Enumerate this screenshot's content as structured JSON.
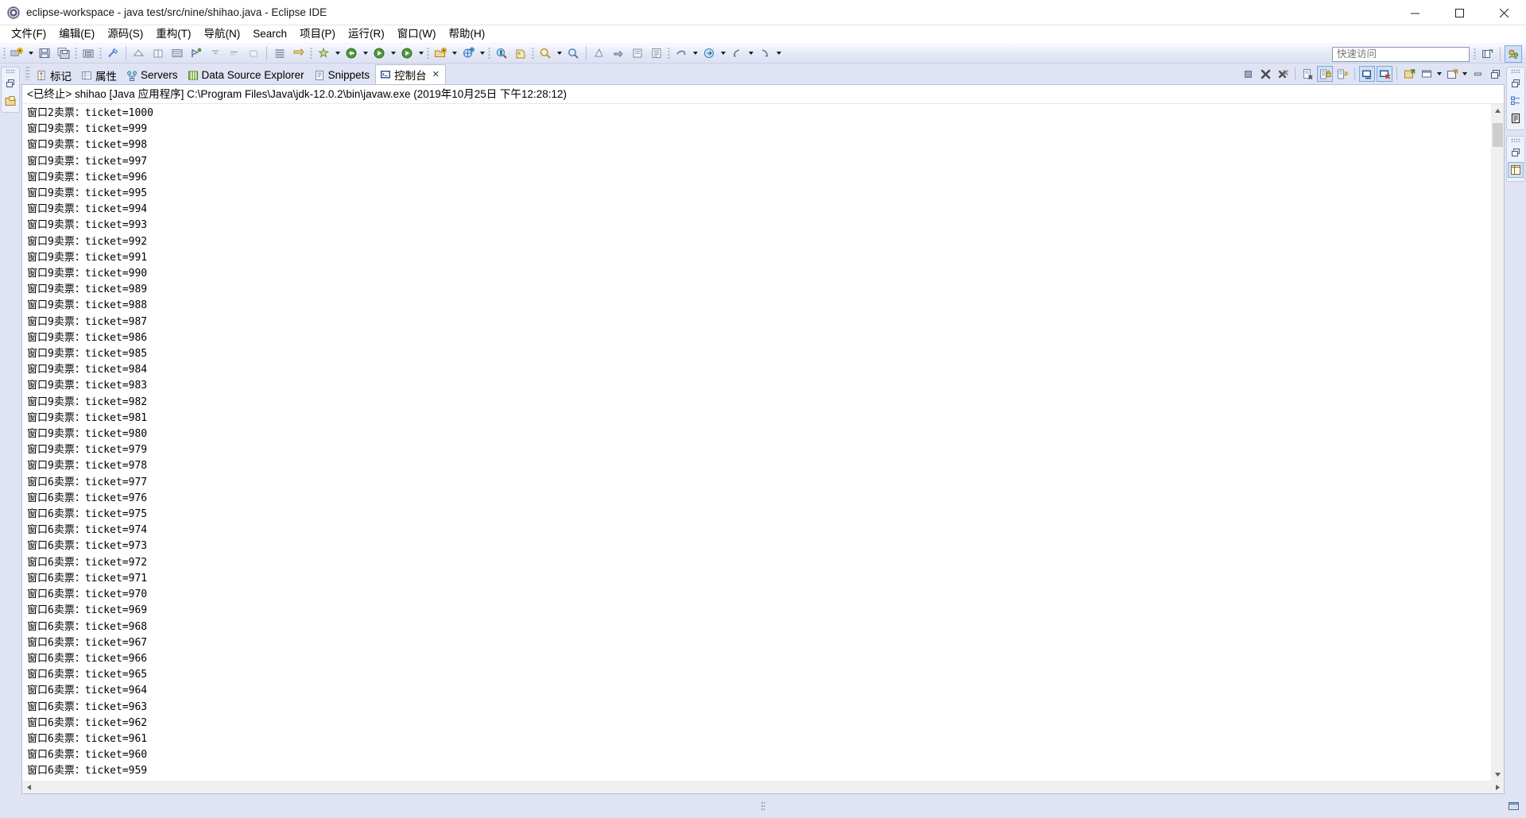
{
  "window": {
    "title": "eclipse-workspace - java test/src/nine/shihao.java - Eclipse IDE",
    "app_icon": "eclipse-icon",
    "minimize_label": "Minimize",
    "maximize_label": "Maximize",
    "close_label": "Close"
  },
  "menubar": {
    "items": [
      {
        "label": "文件(F)",
        "name": "menu-file"
      },
      {
        "label": "编辑(E)",
        "name": "menu-edit"
      },
      {
        "label": "源码(S)",
        "name": "menu-source"
      },
      {
        "label": "重构(T)",
        "name": "menu-refactor"
      },
      {
        "label": "导航(N)",
        "name": "menu-navigate"
      },
      {
        "label": "Search",
        "name": "menu-search"
      },
      {
        "label": "项目(P)",
        "name": "menu-project"
      },
      {
        "label": "运行(R)",
        "name": "menu-run"
      },
      {
        "label": "窗口(W)",
        "name": "menu-window"
      },
      {
        "label": "帮助(H)",
        "name": "menu-help"
      }
    ]
  },
  "toolbar": {
    "quick_access_placeholder": "快速访问",
    "icons": [
      "new-wizard-icon",
      "save-icon",
      "save-all-icon",
      "print-icon",
      "new-java-class-icon",
      "link-editor-icon",
      "open-type-icon",
      "build-all-icon",
      "toggle-breakpoint-icon",
      "debug-icon",
      "run-icon",
      "external-tools-icon",
      "new-package-icon",
      "search-icon",
      "annotation-icon",
      "previous-edit-icon",
      "next-edit-icon",
      "back-icon",
      "forward-icon",
      "pin-editor-icon",
      "perspective-icon"
    ],
    "right_icons": [
      "open-perspective-icon",
      "java-perspective-icon"
    ]
  },
  "views": {
    "tabs": [
      {
        "label": "标记",
        "icon": "markers-icon",
        "active": false
      },
      {
        "label": "属性",
        "icon": "properties-icon",
        "active": false
      },
      {
        "label": "Servers",
        "icon": "servers-icon",
        "active": false
      },
      {
        "label": "Data Source Explorer",
        "icon": "datasource-icon",
        "active": false
      },
      {
        "label": "Snippets",
        "icon": "snippets-icon",
        "active": false
      },
      {
        "label": "控制台",
        "icon": "console-icon",
        "active": true,
        "close_glyph": "✕"
      }
    ],
    "panel_toolbar": [
      {
        "name": "terminate-button",
        "icon": "terminate-icon",
        "toggled": false
      },
      {
        "name": "remove-launch-button",
        "icon": "remove-launch-icon",
        "toggled": false
      },
      {
        "name": "remove-all-terminated-button",
        "icon": "remove-all-icon",
        "toggled": false
      },
      {
        "name": "clear-console-button",
        "icon": "clear-console-icon",
        "toggled": false
      },
      {
        "name": "scroll-lock-button",
        "icon": "scroll-lock-icon",
        "toggled": true
      },
      {
        "name": "word-wrap-button",
        "icon": "word-wrap-icon",
        "toggled": false
      },
      {
        "name": "show-console-on-output-button",
        "icon": "show-stdout-icon",
        "toggled": true
      },
      {
        "name": "show-console-on-error-button",
        "icon": "show-stderr-icon",
        "toggled": true
      },
      {
        "name": "pin-console-button",
        "icon": "pin-console-icon",
        "toggled": false
      },
      {
        "name": "display-selected-console-button",
        "icon": "display-console-icon",
        "toggled": false
      },
      {
        "name": "open-console-button",
        "icon": "open-console-icon",
        "toggled": false
      },
      {
        "name": "minimize-view-button",
        "icon": "minimize-icon",
        "toggled": false
      },
      {
        "name": "maximize-view-button",
        "icon": "maximize-icon",
        "toggled": false
      }
    ]
  },
  "left_fastbar": {
    "items": [
      {
        "name": "restore-left-button",
        "icon": "restore-icon"
      },
      {
        "name": "package-explorer-button",
        "icon": "package-explorer-icon"
      }
    ]
  },
  "right_fastbar": {
    "group1": [
      {
        "name": "restore-right-button",
        "icon": "restore-icon"
      },
      {
        "name": "outline-view-button",
        "icon": "outline-icon"
      },
      {
        "name": "task-list-button",
        "icon": "task-list-icon"
      }
    ],
    "group2": [
      {
        "name": "restore-right-button-2",
        "icon": "restore-icon"
      },
      {
        "name": "editor-area-button",
        "icon": "editor-area-icon"
      }
    ]
  },
  "console": {
    "header": "<已终止> shihao [Java 应用程序] C:\\Program Files\\Java\\jdk-12.0.2\\bin\\javaw.exe  (2019年10月25日 下午12:28:12)",
    "status": "已终止",
    "launch_name": "shihao",
    "launch_type": "Java 应用程序",
    "executable": "C:\\Program Files\\Java\\jdk-12.0.2\\bin\\javaw.exe",
    "timestamp": "2019年10月25日 下午12:28:12",
    "line_template": "窗口{window}卖票：ticket={ticket}",
    "lines": [
      {
        "window": 2,
        "ticket": 1000
      },
      {
        "window": 9,
        "ticket": 999
      },
      {
        "window": 9,
        "ticket": 998
      },
      {
        "window": 9,
        "ticket": 997
      },
      {
        "window": 9,
        "ticket": 996
      },
      {
        "window": 9,
        "ticket": 995
      },
      {
        "window": 9,
        "ticket": 994
      },
      {
        "window": 9,
        "ticket": 993
      },
      {
        "window": 9,
        "ticket": 992
      },
      {
        "window": 9,
        "ticket": 991
      },
      {
        "window": 9,
        "ticket": 990
      },
      {
        "window": 9,
        "ticket": 989
      },
      {
        "window": 9,
        "ticket": 988
      },
      {
        "window": 9,
        "ticket": 987
      },
      {
        "window": 9,
        "ticket": 986
      },
      {
        "window": 9,
        "ticket": 985
      },
      {
        "window": 9,
        "ticket": 984
      },
      {
        "window": 9,
        "ticket": 983
      },
      {
        "window": 9,
        "ticket": 982
      },
      {
        "window": 9,
        "ticket": 981
      },
      {
        "window": 9,
        "ticket": 980
      },
      {
        "window": 9,
        "ticket": 979
      },
      {
        "window": 9,
        "ticket": 978
      },
      {
        "window": 6,
        "ticket": 977
      },
      {
        "window": 6,
        "ticket": 976
      },
      {
        "window": 6,
        "ticket": 975
      },
      {
        "window": 6,
        "ticket": 974
      },
      {
        "window": 6,
        "ticket": 973
      },
      {
        "window": 6,
        "ticket": 972
      },
      {
        "window": 6,
        "ticket": 971
      },
      {
        "window": 6,
        "ticket": 970
      },
      {
        "window": 6,
        "ticket": 969
      },
      {
        "window": 6,
        "ticket": 968
      },
      {
        "window": 6,
        "ticket": 967
      },
      {
        "window": 6,
        "ticket": 966
      },
      {
        "window": 6,
        "ticket": 965
      },
      {
        "window": 6,
        "ticket": 964
      },
      {
        "window": 6,
        "ticket": 963
      },
      {
        "window": 6,
        "ticket": 962
      },
      {
        "window": 6,
        "ticket": 961
      },
      {
        "window": 6,
        "ticket": 960
      },
      {
        "window": 6,
        "ticket": 959
      }
    ]
  },
  "colors": {
    "toolbar_bg": "#e3e7f6",
    "workbench_bg": "#dfe3f3",
    "console_bg": "#ffffff",
    "accent_toggle": "#cfe0f6",
    "text": "#000000"
  }
}
